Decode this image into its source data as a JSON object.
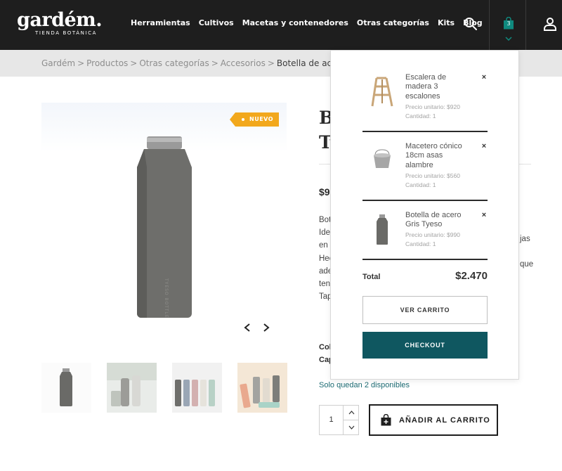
{
  "logo": {
    "main": "gardém.",
    "sub": "TIENDA BOTÁNICA"
  },
  "nav": [
    {
      "label": "Herramientas"
    },
    {
      "label": "Cultivos"
    },
    {
      "label": "Macetas y contenedores"
    },
    {
      "label": "Otras categorías"
    },
    {
      "label": "Kits"
    },
    {
      "label": "Blog"
    }
  ],
  "header_icons": {
    "search": "search-icon",
    "cart": "shopping-bag-icon",
    "user": "user-icon"
  },
  "cart_count": "3",
  "breadcrumb": {
    "items": [
      "Gardém",
      "Productos",
      "Otras categorías",
      "Accesorios"
    ],
    "separator": ">",
    "current": "Botella de acero Gris"
  },
  "product": {
    "badge": "NUEVO",
    "title_visible": "B\nTy",
    "price_visible": "$99",
    "desc_visible": [
      "Bot",
      "Ide",
      "en",
      "Hec",
      "ade",
      "ten",
      "Tap"
    ],
    "desc_right_visible": [
      "jas",
      "que"
    ],
    "attrs_visible": [
      "Col",
      "Cap"
    ],
    "stock": "Solo quedan 2 disponibles",
    "quantity": "1",
    "add_to_cart": "AÑADIR AL CARRITO"
  },
  "minicart": {
    "items": [
      {
        "name": "Escalera de madera 3 escalones",
        "unit": "Precio unitario: $920",
        "qty": "Cantidad: 1"
      },
      {
        "name": "Macetero cónico 18cm asas alambre",
        "unit": "Precio unitario: $560",
        "qty": "Cantidad: 1"
      },
      {
        "name": "Botella de acero Gris Tyeso",
        "unit": "Precio unitario: $990",
        "qty": "Cantidad: 1"
      }
    ],
    "remove_symbol": "×",
    "total_label": "Total",
    "total_value": "$2.470",
    "view_cart": "VER CARRITO",
    "checkout": "CHECKOUT"
  },
  "colors": {
    "header_bg": "#1e1e1e",
    "accent_teal": "#0f5760",
    "badge": "#f2a81c",
    "cart_icon": "#0f8a7f"
  }
}
